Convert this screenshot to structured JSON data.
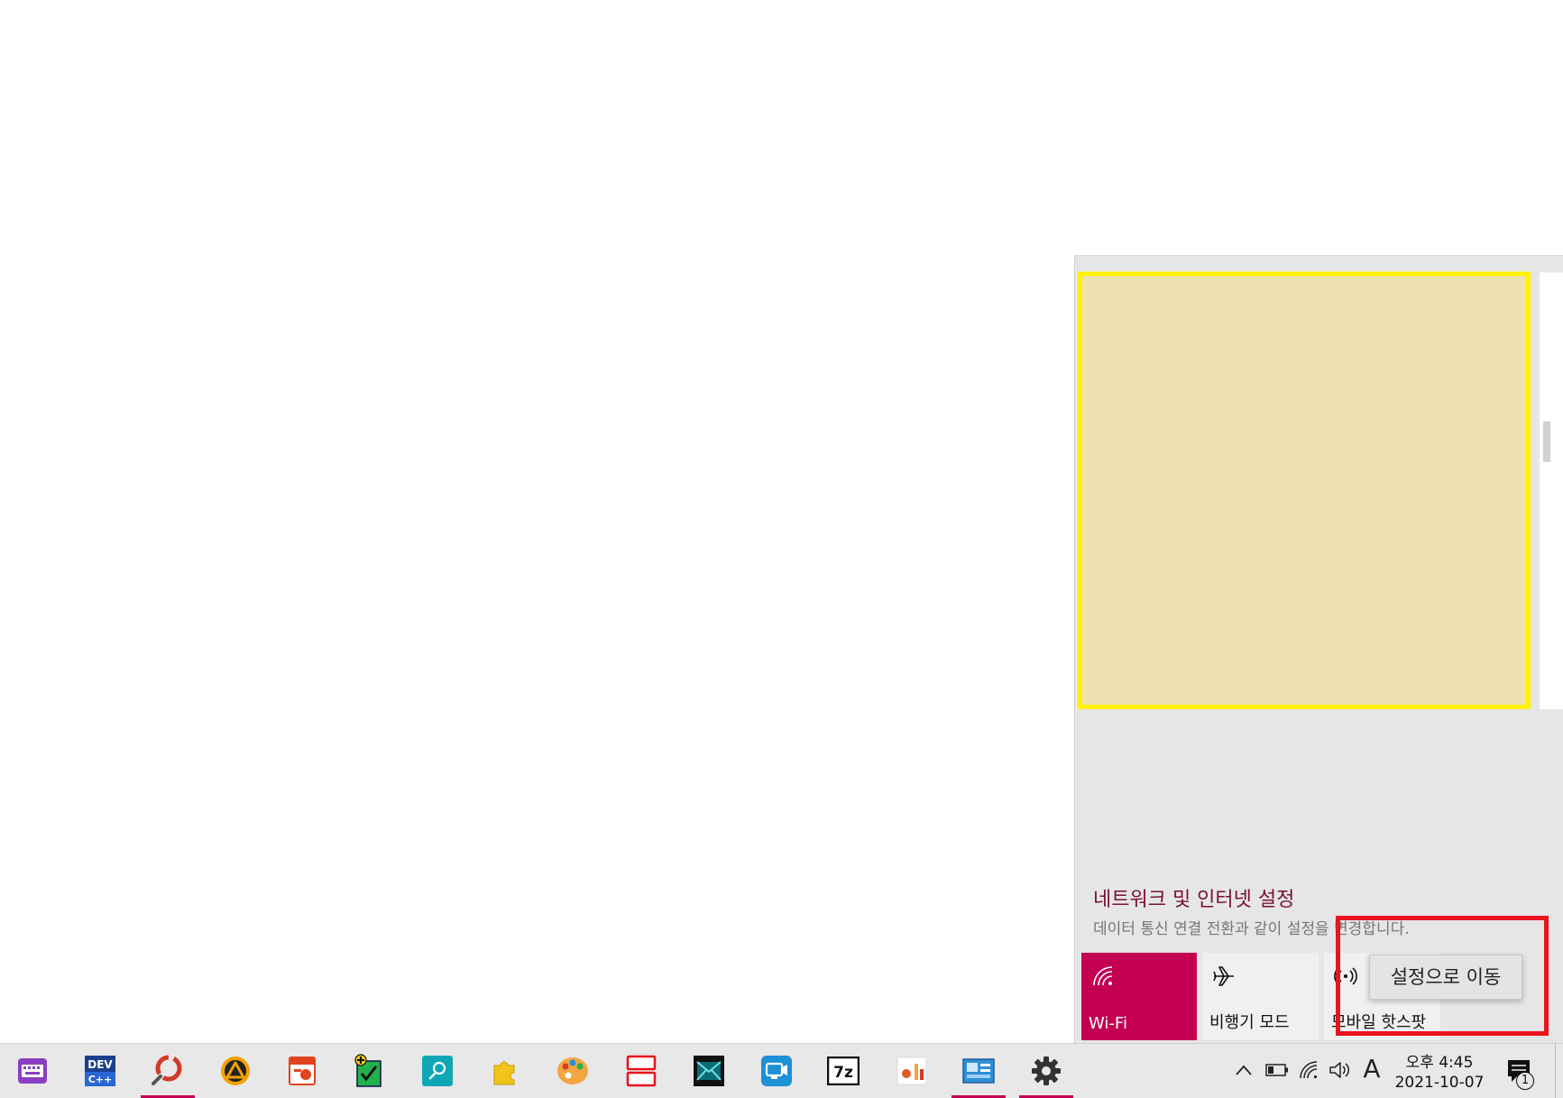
{
  "flyout": {
    "settings_title": "네트워크 및 인터넷 설정",
    "settings_desc": "데이터 통신 연결 전환과 같이 설정을 변경합니다.",
    "tiles": [
      {
        "label": "Wi-Fi",
        "icon": "wifi-icon",
        "active": true
      },
      {
        "label": "비행기 모드",
        "icon": "airplane-icon",
        "active": false
      },
      {
        "label": "모바일 핫스팟",
        "icon": "hotspot-icon",
        "active": false
      }
    ],
    "tooltip": "설정으로 이동"
  },
  "taskbar": {
    "apps": [
      {
        "name": "keyboard-app-icon",
        "color": "#8a3fc0"
      },
      {
        "name": "devcpp-app-icon",
        "color": "#1b3f8f"
      },
      {
        "name": "photoscape-app-icon",
        "color": "#d23a2a"
      },
      {
        "name": "aimp-app-icon",
        "color": "#f5a000"
      },
      {
        "name": "hancom-show-app-icon",
        "color": "#e2431e"
      },
      {
        "name": "checklist-app-icon",
        "color": "#22b24c"
      },
      {
        "name": "search-app-icon",
        "color": "#10a7b4"
      },
      {
        "name": "puzzle-app-icon",
        "color": "#f0c419"
      },
      {
        "name": "paint-app-icon",
        "color": "#f2a541"
      },
      {
        "name": "split-app-icon",
        "color": "#e8141e"
      },
      {
        "name": "mail-app-icon",
        "color": "#0c6b74"
      },
      {
        "name": "screen-recorder-app-icon",
        "color": "#1e90d6"
      },
      {
        "name": "7zip-app-icon",
        "color": "#111111"
      },
      {
        "name": "chart-app-icon",
        "color": "#e25a2a"
      },
      {
        "name": "control-panel-app-icon",
        "color": "#2f8fd8"
      },
      {
        "name": "settings-app-icon",
        "color": "#333333"
      }
    ],
    "ime": "A",
    "clock_time": "오후 4:45",
    "clock_date": "2021-10-07",
    "notification_count": "1",
    "accent": "#c30052"
  }
}
